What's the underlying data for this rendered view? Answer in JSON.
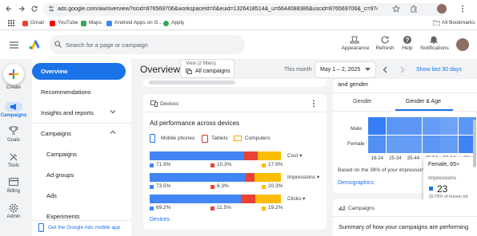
{
  "browser": {
    "url": "ads.google.com/aw/overview?ocid=876569706&workspaceId=0&euid=1326418514&_u=6644088386&uscid=876569706&_c=9740010394...",
    "bookmarks": [
      "Gmail",
      "YouTube",
      "Maps",
      "Android Apps on G...",
      "Apply"
    ],
    "all_bookmarks": "All Bookmarks"
  },
  "header": {
    "search_placeholder": "Search for a page or campaign",
    "tools": [
      "Appearance",
      "Refresh",
      "Help",
      "Notifications"
    ]
  },
  "rail": {
    "items": [
      "Create",
      "Campaigns",
      "Goals",
      "Tools",
      "Billing",
      "Admin"
    ]
  },
  "nav": {
    "items": [
      "Overview",
      "Recommendations",
      "Insights and reports",
      "Campaigns",
      "Campaigns",
      "Ad groups",
      "Ads",
      "Experiments"
    ],
    "app_promo": "Get the Google Ads mobile app"
  },
  "toolbar": {
    "page_title": "Overview",
    "view_label": "View (2 filters)",
    "view_value": "All campaigns",
    "date_prefix": "This month",
    "date_range": "May 1 – 2, 2025",
    "show_last": "Show last 30 days"
  },
  "devices_card": {
    "title": "Devices",
    "subtitle": "Ad performance across devices",
    "legend": [
      "Mobile phones",
      "Tablets",
      "Computers"
    ],
    "metrics": [
      "Cost",
      "Impressions",
      "Clicks"
    ],
    "link": "Devices",
    "colors": {
      "mobile": "#4285f4",
      "tablets": "#ea4335",
      "computers": "#fbbc04"
    }
  },
  "chart_data": {
    "type": "bar",
    "stacked": true,
    "orientation": "horizontal",
    "categories": [
      "Cost",
      "Impressions",
      "Clicks"
    ],
    "series": [
      {
        "name": "Mobile phones",
        "values": [
          71.9,
          73.5,
          69.2
        ],
        "labels": [
          "71.9%",
          "73.5%",
          "69.2%"
        ]
      },
      {
        "name": "Tablets",
        "values": [
          10.3,
          6.3,
          11.5
        ],
        "labels": [
          "10.3%",
          "6.3%",
          "11.5%"
        ]
      },
      {
        "name": "Computers",
        "values": [
          17.9,
          20.3,
          19.2
        ],
        "labels": [
          "17.9%",
          "20.3%",
          "19.2%"
        ]
      }
    ]
  },
  "demo_card": {
    "title_fragment": "and gender",
    "tabs": [
      "Gender",
      "Gender & Age"
    ],
    "rows": [
      "Male",
      "Female"
    ],
    "cols": [
      "18-24",
      "25-34",
      "35-44",
      "45-54",
      "55-64",
      "65+"
    ],
    "heat": [
      [
        0.75,
        0.55,
        0.55,
        0.5,
        0.45,
        0.55
      ],
      [
        0.6,
        0.5,
        0.5,
        0.55,
        0.5,
        0.7
      ]
    ],
    "note": "Based on the 39% of your impressions w",
    "link": "Demographics",
    "tooltip": {
      "title": "Female, 65+",
      "label": "Impressions",
      "value": "23",
      "sub": "(9.75% of known tot"
    }
  },
  "campaigns_card": {
    "title": "Campaigns",
    "summary": "Summary of how your campaigns are performing"
  }
}
